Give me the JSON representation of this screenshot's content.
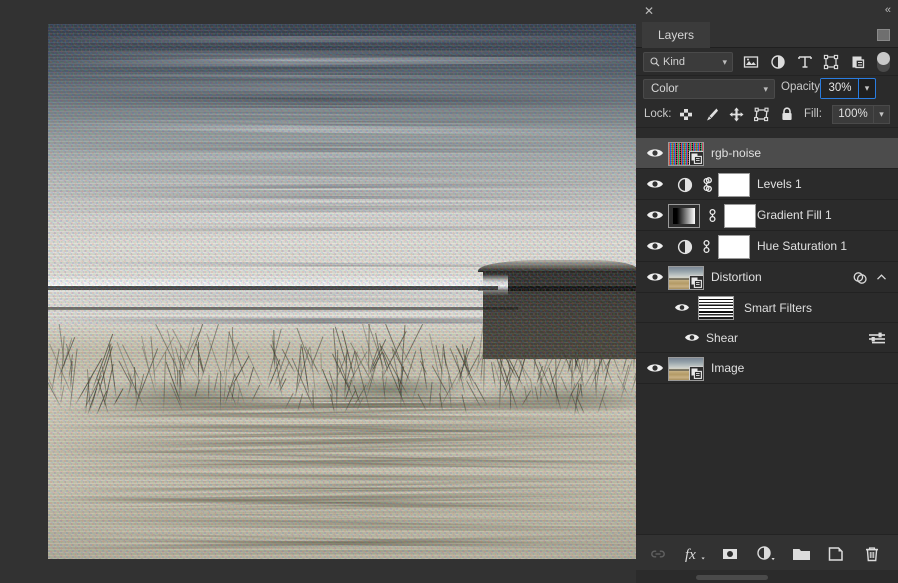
{
  "app": {
    "panel_title": "Layers",
    "close_icon": "close-icon",
    "collapse_icon": "collapse-double-chevron-icon",
    "menu_icon": "panel-menu-icon"
  },
  "filter_bar": {
    "kind_label": "Kind",
    "search_icon": "search-icon",
    "chevron": "∨",
    "filter_buttons": [
      {
        "name": "filter-pixel-layers",
        "icon": "image-icon"
      },
      {
        "name": "filter-adjustment-layers",
        "icon": "adjustment-half-circle-icon"
      },
      {
        "name": "filter-type-layers",
        "icon": "type-t-icon"
      },
      {
        "name": "filter-shape-layers",
        "icon": "shape-bounding-box-icon"
      },
      {
        "name": "filter-smart-objects",
        "icon": "smart-object-icon"
      }
    ],
    "toggle_name": "filter-enable-toggle"
  },
  "blend_row": {
    "blend_mode": "Color",
    "opacity_label": "Opacity:",
    "opacity_value": "30%",
    "opacity_focused": true,
    "focus_color": "#2a7de1"
  },
  "lock_row": {
    "lock_label": "Lock:",
    "lock_buttons": [
      {
        "name": "lock-transparent-pixels",
        "icon": "checkerboard-icon"
      },
      {
        "name": "lock-image-pixels",
        "icon": "brush-icon"
      },
      {
        "name": "lock-position",
        "icon": "move-arrows-icon"
      },
      {
        "name": "lock-artboard-nesting",
        "icon": "artboard-icon"
      },
      {
        "name": "lock-all",
        "icon": "padlock-icon"
      }
    ],
    "fill_label": "Fill:",
    "fill_value": "100%"
  },
  "layers": [
    {
      "name": "rgb-noise",
      "type": "smart-object",
      "thumb": "rgb-noise-thumbnail",
      "selected": true,
      "visible": true,
      "has_mask": false,
      "linked": false
    },
    {
      "name": "Levels 1",
      "type": "adjustment",
      "thumb": "levels-adjustment-icon",
      "selected": false,
      "visible": true,
      "has_mask": true,
      "linked": true
    },
    {
      "name": "Gradient Fill 1",
      "type": "fill",
      "thumb": "gradient-fill-thumbnail",
      "selected": false,
      "visible": true,
      "has_mask": true,
      "linked": true
    },
    {
      "name": "Hue Saturation 1",
      "type": "adjustment",
      "thumb": "hue-saturation-adjustment-icon",
      "selected": false,
      "visible": true,
      "has_mask": true,
      "linked": true
    },
    {
      "name": "Distortion",
      "type": "smart-object",
      "thumb": "photo-thumbnail",
      "selected": false,
      "visible": true,
      "has_mask": false,
      "linked": false,
      "expanded": true,
      "right_icons": [
        "smart-filter-indicator-icon",
        "collapse-chevron-up-icon"
      ]
    },
    {
      "name": "Smart Filters",
      "type": "smart-filters-group",
      "thumb": "smart-filters-mask-thumbnail",
      "visible": true,
      "indent": 1
    },
    {
      "name": "Shear",
      "type": "smart-filter",
      "visible": true,
      "indent": 2,
      "right_icons": [
        "filter-blending-options-icon"
      ]
    },
    {
      "name": "Image",
      "type": "smart-object",
      "thumb": "photo-thumbnail",
      "selected": false,
      "visible": true,
      "has_mask": false,
      "linked": false
    }
  ],
  "footer_buttons": [
    {
      "name": "link-layers-button",
      "icon": "link-chain-icon",
      "disabled": true
    },
    {
      "name": "add-layer-style-button",
      "icon": "fx-icon",
      "disabled": false
    },
    {
      "name": "add-layer-mask-button",
      "icon": "mask-icon",
      "disabled": false
    },
    {
      "name": "new-fill-adjustment-layer-button",
      "icon": "half-circle-icon",
      "disabled": false
    },
    {
      "name": "new-group-button",
      "icon": "folder-icon",
      "disabled": false
    },
    {
      "name": "new-layer-button",
      "icon": "new-layer-page-icon",
      "disabled": false
    },
    {
      "name": "delete-layer-button",
      "icon": "trash-icon",
      "disabled": false
    }
  ],
  "canvas": {
    "description": "distorted-beach-photograph",
    "background_color": "#323232"
  }
}
